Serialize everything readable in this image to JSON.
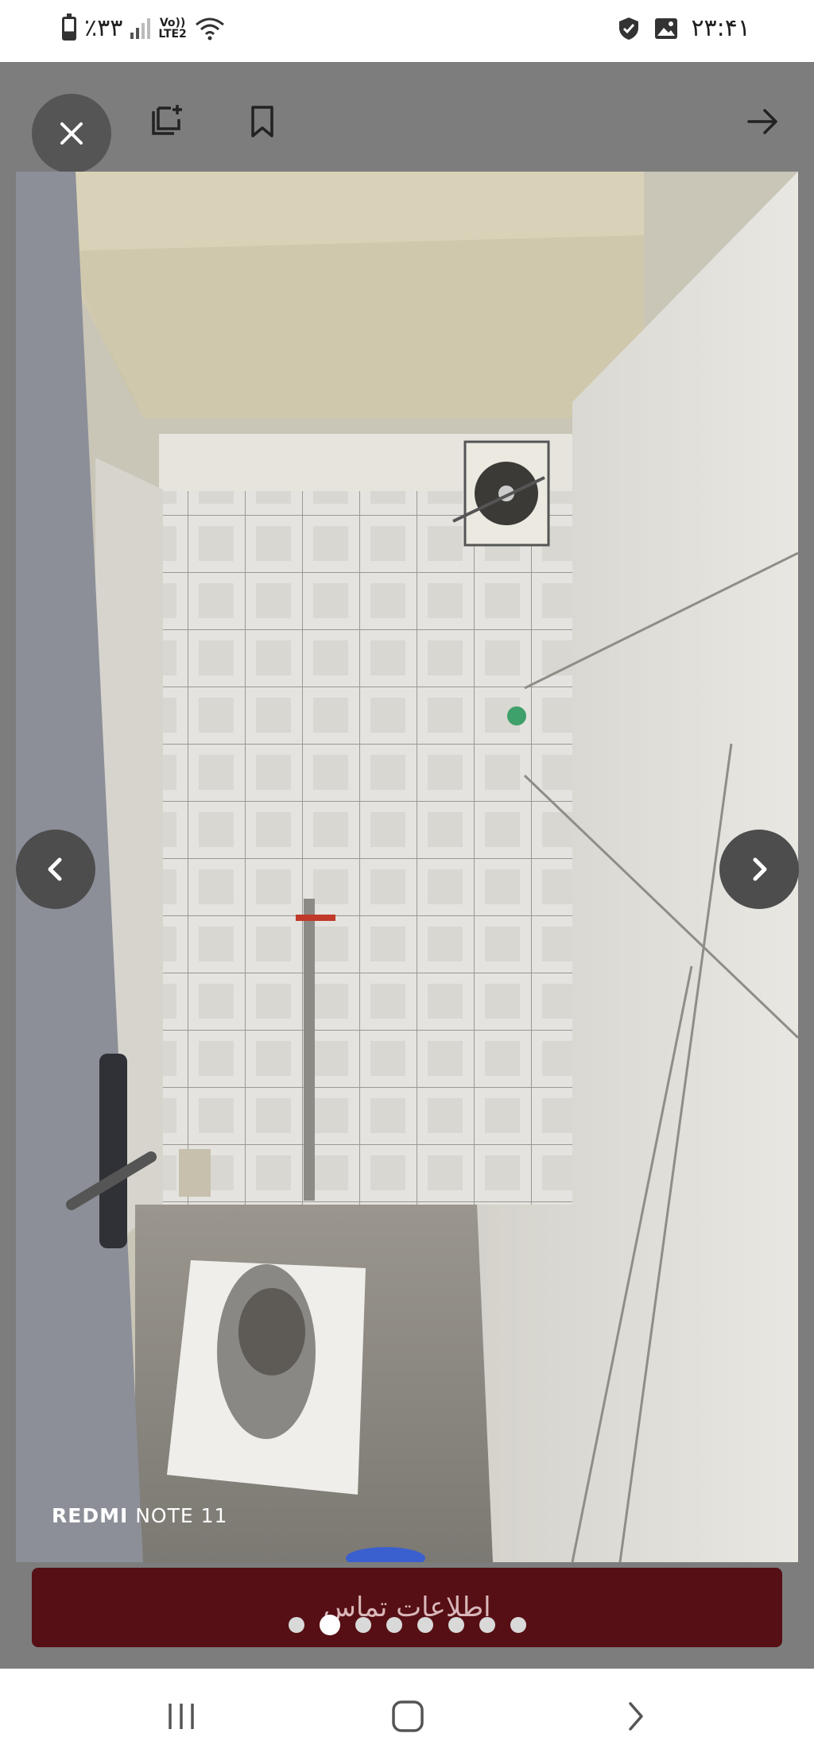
{
  "status_bar": {
    "battery_text": "٪۳۳",
    "volte_top": "Vo))",
    "volte_bottom": "LTE2",
    "time": "۲۳:۴۱",
    "icons": [
      "battery-icon",
      "signal-icon",
      "volte-icon",
      "wifi-icon",
      "shield-check-icon",
      "gallery-icon"
    ]
  },
  "viewer": {
    "toolbar": {
      "close_icon": "close-icon",
      "add_to_list_icon": "add-to-list-icon",
      "bookmark_icon": "bookmark-icon",
      "forward_icon": "arrow-forward-icon"
    },
    "photo": {
      "subject": "bathroom photo",
      "watermark_brand": "REDMI",
      "watermark_model": "NOTE 11"
    },
    "prev_icon": "chevron-left-icon",
    "next_icon": "chevron-right-icon",
    "contact_button_label": "اطلاعات تماس",
    "pagination": {
      "total": 8,
      "current": 2
    }
  },
  "system_nav": {
    "recents_icon": "recents-icon",
    "home_icon": "home-icon",
    "back_icon": "back-chevron-icon"
  },
  "colors": {
    "overlay": "#7d7d7d",
    "contact_button": "#560f14",
    "close_button": "#555555"
  }
}
